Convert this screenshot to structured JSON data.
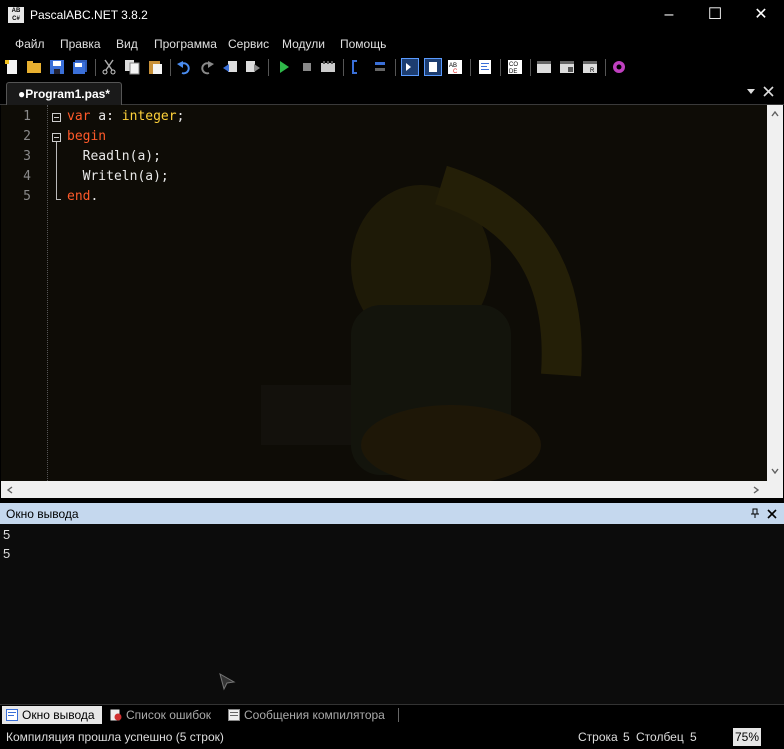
{
  "window": {
    "title": "PascalABC.NET 3.8.2",
    "icon_label": "AB C#"
  },
  "menu": [
    "Файл",
    "Правка",
    "Вид",
    "Программа",
    "Сервис",
    "Модули",
    "Помощь"
  ],
  "editor_tab": {
    "label": "●Program1.pas*"
  },
  "code": {
    "line_numbers": [
      "1",
      "2",
      "3",
      "4",
      "5"
    ],
    "line1": {
      "kw1": "var",
      "rest1": " a: ",
      "kw2": "integer",
      "rest2": ";"
    },
    "line2": {
      "kw": "begin"
    },
    "line3": {
      "text": "  Readln(a);"
    },
    "line4": {
      "text": "  Writeln(a);"
    },
    "line5": {
      "kw": "end",
      "rest": "."
    }
  },
  "output_panel": {
    "title": "Окно вывода",
    "lines": [
      "5",
      "5"
    ]
  },
  "bottom_tabs": [
    "Окно вывода",
    "Список ошибок",
    "Сообщения компилятора"
  ],
  "status": {
    "message": "Компиляция прошла успешно (5 строк)",
    "row_label": "Строка",
    "row_value": "5",
    "col_label": "Столбец",
    "col_value": "5",
    "zoom": "75%"
  },
  "colors": {
    "keyword": "#ff5a2a",
    "type": "#ffd23a",
    "panel_header": "#c5d8ee"
  },
  "icons": [
    "new-file-icon",
    "open-folder-icon",
    "save-icon",
    "save-all-icon",
    "cut-icon",
    "copy-icon",
    "paste-icon",
    "undo-icon",
    "redo-icon",
    "navigate-back-icon",
    "navigate-forward-icon",
    "run-icon",
    "stop-icon",
    "compile-icon",
    "debug-step-icon",
    "debug-step-into-icon",
    "output-window-icon",
    "text-icon",
    "spell-icon",
    "format-icon",
    "code-icon",
    "window-1-icon",
    "window-2-icon",
    "window-3-icon",
    "settings-gear-icon"
  ]
}
